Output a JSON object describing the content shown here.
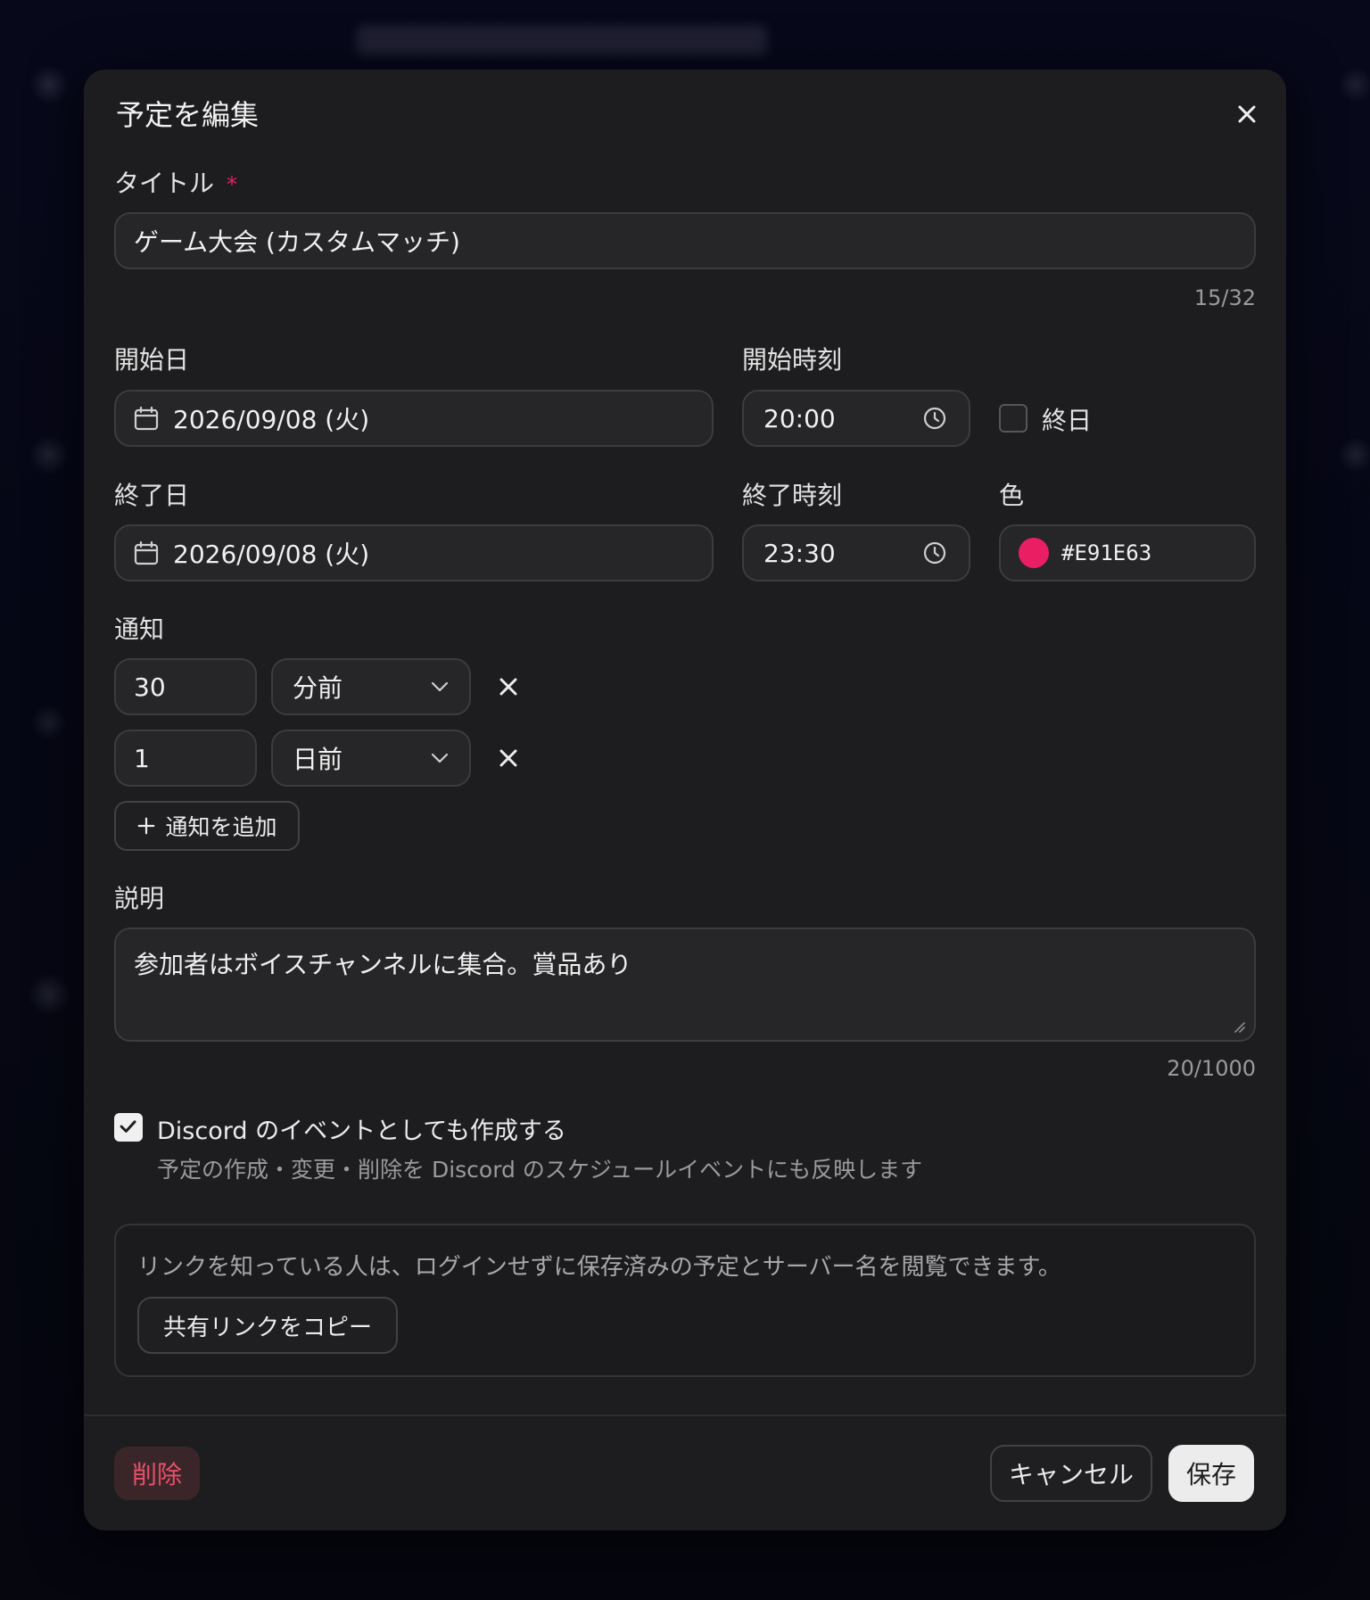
{
  "modal": {
    "title": "予定を編集",
    "close_icon": "close-icon"
  },
  "title_field": {
    "label": "タイトル",
    "required_mark": "*",
    "value": "ゲーム大会 (カスタムマッチ)",
    "counter": "15/32"
  },
  "start": {
    "date_label": "開始日",
    "date_value": "2026/09/08 (火)",
    "time_label": "開始時刻",
    "time_value": "20:00"
  },
  "all_day": {
    "label": "終日",
    "checked": false
  },
  "end": {
    "date_label": "終了日",
    "date_value": "2026/09/08 (火)",
    "time_label": "終了時刻",
    "time_value": "23:30"
  },
  "color": {
    "label": "色",
    "value": "#E91E63"
  },
  "notifications": {
    "label": "通知",
    "items": [
      {
        "amount": "30",
        "unit": "分前"
      },
      {
        "amount": "1",
        "unit": "日前"
      }
    ],
    "add_label": "通知を追加"
  },
  "description": {
    "label": "説明",
    "value": "参加者はボイスチャンネルに集合。賞品あり",
    "counter": "20/1000"
  },
  "discord": {
    "checked": true,
    "label": "Discord のイベントとしても作成する",
    "hint": "予定の作成・変更・削除を Discord のスケジュールイベントにも反映します"
  },
  "share": {
    "notice": "リンクを知っている人は、ログインせずに保存済みの予定とサーバー名を閲覧できます。",
    "copy_label": "共有リンクをコピー"
  },
  "footer": {
    "delete_label": "削除",
    "cancel_label": "キャンセル",
    "save_label": "保存"
  },
  "colors": {
    "accent": "#E91E63",
    "modal_bg": "#1d1d1f",
    "backdrop": "#05060e"
  }
}
